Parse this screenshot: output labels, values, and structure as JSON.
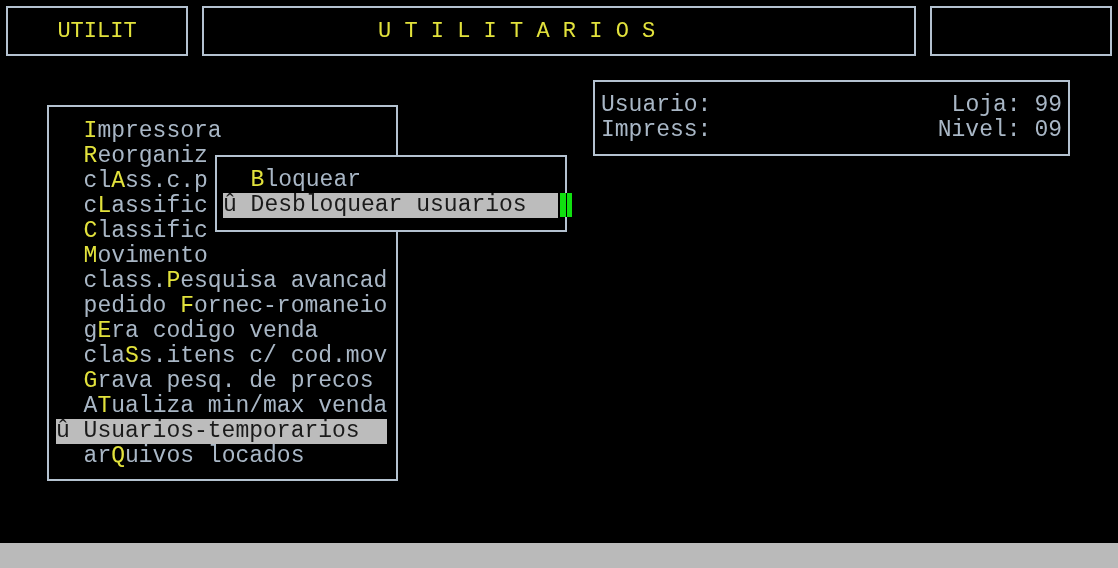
{
  "header": {
    "module": "UTILIT",
    "title": "U T I L I T A R I O S"
  },
  "info": {
    "rows": [
      {
        "left": "Usuario:",
        "right": "Loja: 99"
      },
      {
        "left": "Impress:",
        "right": "Nivel: 09"
      }
    ]
  },
  "menu": {
    "items": [
      {
        "hotkey": "I",
        "rest": "mpressora",
        "selected": false
      },
      {
        "hotkey": "R",
        "rest": "eorganiz",
        "selected": false
      },
      {
        "prefix": "cl",
        "hotkey": "A",
        "rest": "ss.c.p",
        "selected": false
      },
      {
        "prefix": "c",
        "hotkey": "L",
        "rest": "assific",
        "selected": false
      },
      {
        "hotkey": "C",
        "rest": "lassific",
        "selected": false
      },
      {
        "hotkey": "M",
        "rest": "ovimento",
        "selected": false
      },
      {
        "prefix": "class.",
        "hotkey": "P",
        "rest": "esquisa avancad",
        "selected": false
      },
      {
        "prefix": "pedido ",
        "hotkey": "F",
        "rest": "ornec-romaneio",
        "selected": false
      },
      {
        "prefix": "g",
        "hotkey": "E",
        "rest": "ra codigo venda",
        "selected": false
      },
      {
        "prefix": "cla",
        "hotkey": "S",
        "rest": "s.itens c/ cod.mov",
        "selected": false
      },
      {
        "hotkey": "G",
        "rest": "rava pesq. de precos",
        "selected": false
      },
      {
        "prefix": "A",
        "hotkey": "T",
        "rest": "ualiza min/max venda",
        "selected": false
      },
      {
        "marker": "û",
        "prefix": "Usuarios-temporarios",
        "selected": true
      },
      {
        "prefix": "ar",
        "hotkey": "Q",
        "rest": "uivos locados",
        "selected": false
      }
    ]
  },
  "submenu": {
    "items": [
      {
        "hotkey": "B",
        "rest": "loquear",
        "selected": false
      },
      {
        "marker": "û",
        "prefix": "Desbloquear usuarios",
        "selected": true
      }
    ]
  }
}
